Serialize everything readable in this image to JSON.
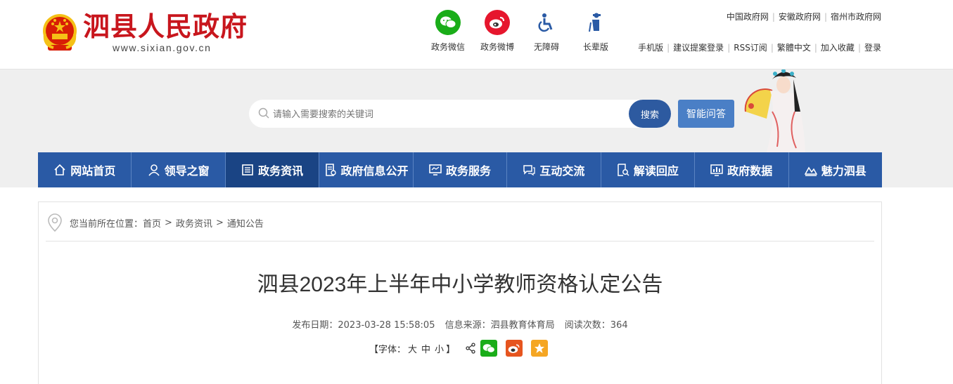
{
  "header": {
    "title": "泗县人民政府",
    "url": "www.sixian.gov.cn",
    "quick_links": [
      {
        "label": "政务微信",
        "icon": "wechat-icon",
        "color": "#1aad19"
      },
      {
        "label": "政务微博",
        "icon": "weibo-icon",
        "color": "#e6162d"
      },
      {
        "label": "无障碍",
        "icon": "accessibility-icon",
        "color": "#2a5aa5"
      },
      {
        "label": "长辈版",
        "icon": "elder-icon",
        "color": "#2a5aa5"
      }
    ],
    "top_links": [
      "中国政府网",
      "安徽政府网",
      "宿州市政府网"
    ],
    "tool_links": [
      "手机版",
      "建议提案登录",
      "RSS订阅",
      "繁體中文",
      "加入收藏",
      "登录"
    ]
  },
  "search": {
    "placeholder": "请输入需要搜索的关键词",
    "button": "搜索",
    "ask_button": "智能问答"
  },
  "nav": {
    "items": [
      {
        "label": "网站首页",
        "icon": "home-icon"
      },
      {
        "label": "领导之窗",
        "icon": "person-icon"
      },
      {
        "label": "政务资讯",
        "icon": "news-icon",
        "active": true
      },
      {
        "label": "政府信息公开",
        "icon": "document-icon"
      },
      {
        "label": "政务服务",
        "icon": "monitor-icon"
      },
      {
        "label": "互动交流",
        "icon": "chat-icon"
      },
      {
        "label": "解读回应",
        "icon": "search-doc-icon"
      },
      {
        "label": "政府数据",
        "icon": "chart-icon"
      },
      {
        "label": "魅力泗县",
        "icon": "landscape-icon"
      }
    ]
  },
  "breadcrumb": {
    "prefix": "您当前所在位置：",
    "items": [
      "首页",
      "政务资讯",
      "通知公告"
    ]
  },
  "article": {
    "title": "泗县2023年上半年中小学教师资格认定公告",
    "publish_label": "发布日期：",
    "publish_date": "2023-03-28 15:58:05",
    "source_label": "信息来源：",
    "source": "泗县教育体育局",
    "views_label": "阅读次数：",
    "views": "364"
  },
  "font_size": {
    "open": "【字体：",
    "large": "大",
    "medium": "中",
    "small": "小",
    "close": "】"
  },
  "share": [
    {
      "icon": "wechat-icon",
      "color": "#1aad19"
    },
    {
      "icon": "weibo-icon",
      "color": "#e6551f"
    },
    {
      "icon": "star-icon",
      "color": "#f5a623"
    }
  ]
}
